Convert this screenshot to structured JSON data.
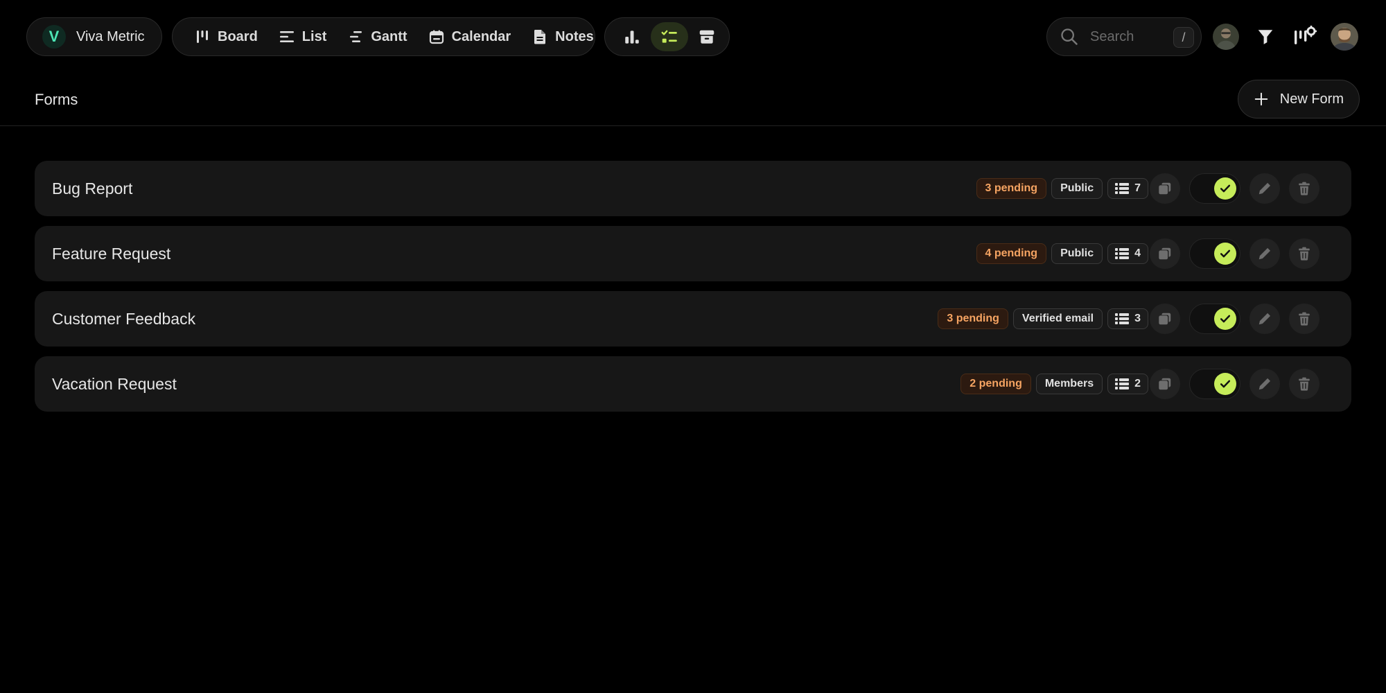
{
  "workspace": {
    "initial": "V",
    "name": "Viva Metric",
    "accent": "#4de6b5"
  },
  "views": [
    {
      "label": "Board",
      "icon": "board-icon"
    },
    {
      "label": "List",
      "icon": "list-icon"
    },
    {
      "label": "Gantt",
      "icon": "gantt-icon"
    },
    {
      "label": "Calendar",
      "icon": "calendar-icon"
    },
    {
      "label": "Notes",
      "icon": "notes-icon"
    }
  ],
  "tools": [
    {
      "icon": "bar-chart-icon",
      "active": false
    },
    {
      "icon": "checklist-icon",
      "active": true
    },
    {
      "icon": "archive-icon",
      "active": false
    }
  ],
  "search": {
    "placeholder": "Search",
    "shortcut": "/"
  },
  "page": {
    "title": "Forms",
    "new_form_label": "New Form"
  },
  "colors": {
    "pending": "#f6a462",
    "toggle_on": "#c6ec5a",
    "active_tool": "#c6ec5a"
  },
  "forms": [
    {
      "name": "Bug Report",
      "pending": "3 pending",
      "access": "Public",
      "fields": "7",
      "enabled": true
    },
    {
      "name": "Feature Request",
      "pending": "4 pending",
      "access": "Public",
      "fields": "4",
      "enabled": true
    },
    {
      "name": "Customer Feedback",
      "pending": "3 pending",
      "access": "Verified email",
      "fields": "3",
      "enabled": true
    },
    {
      "name": "Vacation Request",
      "pending": "2 pending",
      "access": "Members",
      "fields": "2",
      "enabled": true
    }
  ]
}
